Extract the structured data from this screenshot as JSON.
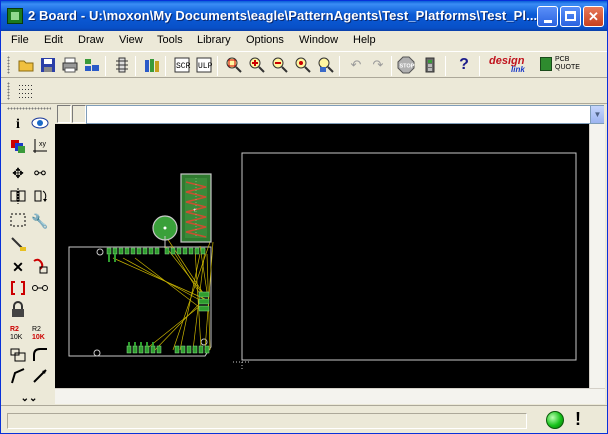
{
  "window": {
    "title": "2 Board - U:\\moxon\\My Documents\\eagle\\PatternAgents\\Test_Platforms\\Test_Pl...",
    "controls": [
      "minimize",
      "maximize",
      "close"
    ]
  },
  "menu": {
    "items": [
      {
        "label": "File"
      },
      {
        "label": "Edit"
      },
      {
        "label": "Draw"
      },
      {
        "label": "View"
      },
      {
        "label": "Tools"
      },
      {
        "label": "Library"
      },
      {
        "label": "Options"
      },
      {
        "label": "Window"
      },
      {
        "label": "Help"
      }
    ]
  },
  "toolbar": {
    "icons": [
      "open-icon",
      "save-icon",
      "print-icon",
      "cam-icon",
      "drc-icon",
      "library-icon",
      "script-icon",
      "ulp-icon",
      "zoom-fit-icon",
      "zoom-in-icon",
      "zoom-out-icon",
      "zoom-select-icon",
      "redraw-icon",
      "undo-icon",
      "redo-icon",
      "stop-icon",
      "go-icon",
      "help-icon",
      "design-link-icon",
      "pcb-quote-icon"
    ],
    "stop_label": "STOP",
    "help_label": "?",
    "design_link": {
      "line1": "design",
      "line2": "link"
    },
    "pcb_quote": {
      "line1": "PCB",
      "line2": "QUOTE"
    }
  },
  "command": {
    "value": "",
    "placeholder": ""
  },
  "tools": {
    "icons": [
      "info-icon",
      "show-icon",
      "display-icon",
      "mark-icon",
      "move-icon",
      "copy-icon",
      "mirror-icon",
      "rotate-icon",
      "group-icon",
      "change-icon",
      "paste-icon",
      "delete-icon",
      "add-icon",
      "replace-icon",
      "lock-icon",
      "smash-icon",
      "name-icon",
      "value-icon",
      "split-icon",
      "miter-icon",
      "optimize-icon",
      "route-icon",
      "more-icon"
    ]
  },
  "status": {
    "text": "",
    "indicator": "ready",
    "colors": {
      "ok": "#16c21a"
    }
  },
  "colors": {
    "canvas": "#000000",
    "board_outline": "#c8c8c8",
    "pad_green": "#2f9e2f",
    "airwire": "#c8b400",
    "titlebar": "#0b5bd6"
  }
}
